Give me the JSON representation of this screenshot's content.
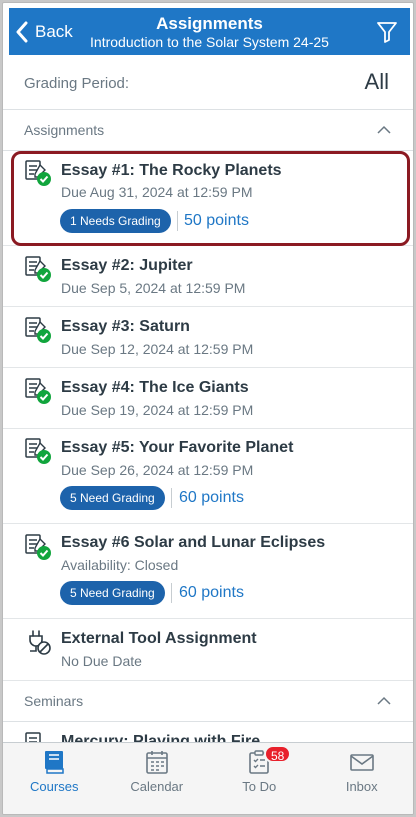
{
  "header": {
    "back_label": "Back",
    "title": "Assignments",
    "subtitle": "Introduction to the Solar System  24-25"
  },
  "grading_period": {
    "label": "Grading Period:",
    "value": "All"
  },
  "sections": {
    "assignments": "Assignments",
    "seminars": "Seminars"
  },
  "assignments": [
    {
      "name": "Essay #1: The Rocky Planets",
      "due": "Due Aug 31, 2024 at 12:59 PM",
      "badge": "1 Needs Grading",
      "points": "50 points"
    },
    {
      "name": "Essay #2: Jupiter",
      "due": "Due Sep 5, 2024 at 12:59 PM"
    },
    {
      "name": "Essay #3: Saturn",
      "due": "Due Sep 12, 2024 at 12:59 PM"
    },
    {
      "name": "Essay #4: The Ice Giants",
      "due": "Due Sep 19, 2024 at 12:59 PM"
    },
    {
      "name": "Essay #5: Your Favorite Planet",
      "due": "Due Sep 26, 2024 at 12:59 PM",
      "badge": "5 Need Grading",
      "points": "60 points"
    },
    {
      "name": "Essay #6 Solar and Lunar Eclipses",
      "due": "Availability: Closed",
      "badge": "5 Need Grading",
      "points": "60 points"
    },
    {
      "name": "External Tool Assignment",
      "due": "No Due Date"
    }
  ],
  "seminars": [
    {
      "name": "Mercury: Playing with Fire"
    }
  ],
  "tabs": [
    {
      "label": "Courses",
      "icon": "courses-icon"
    },
    {
      "label": "Calendar",
      "icon": "calendar-icon"
    },
    {
      "label": "To Do",
      "icon": "todo-icon",
      "badge": "58"
    },
    {
      "label": "Inbox",
      "icon": "inbox-icon"
    }
  ],
  "colors": {
    "brand": "#1f77c6",
    "badge": "#1d63ab",
    "success": "#11a53d",
    "highlight": "#8b1a22",
    "notification": "#e8202b"
  }
}
